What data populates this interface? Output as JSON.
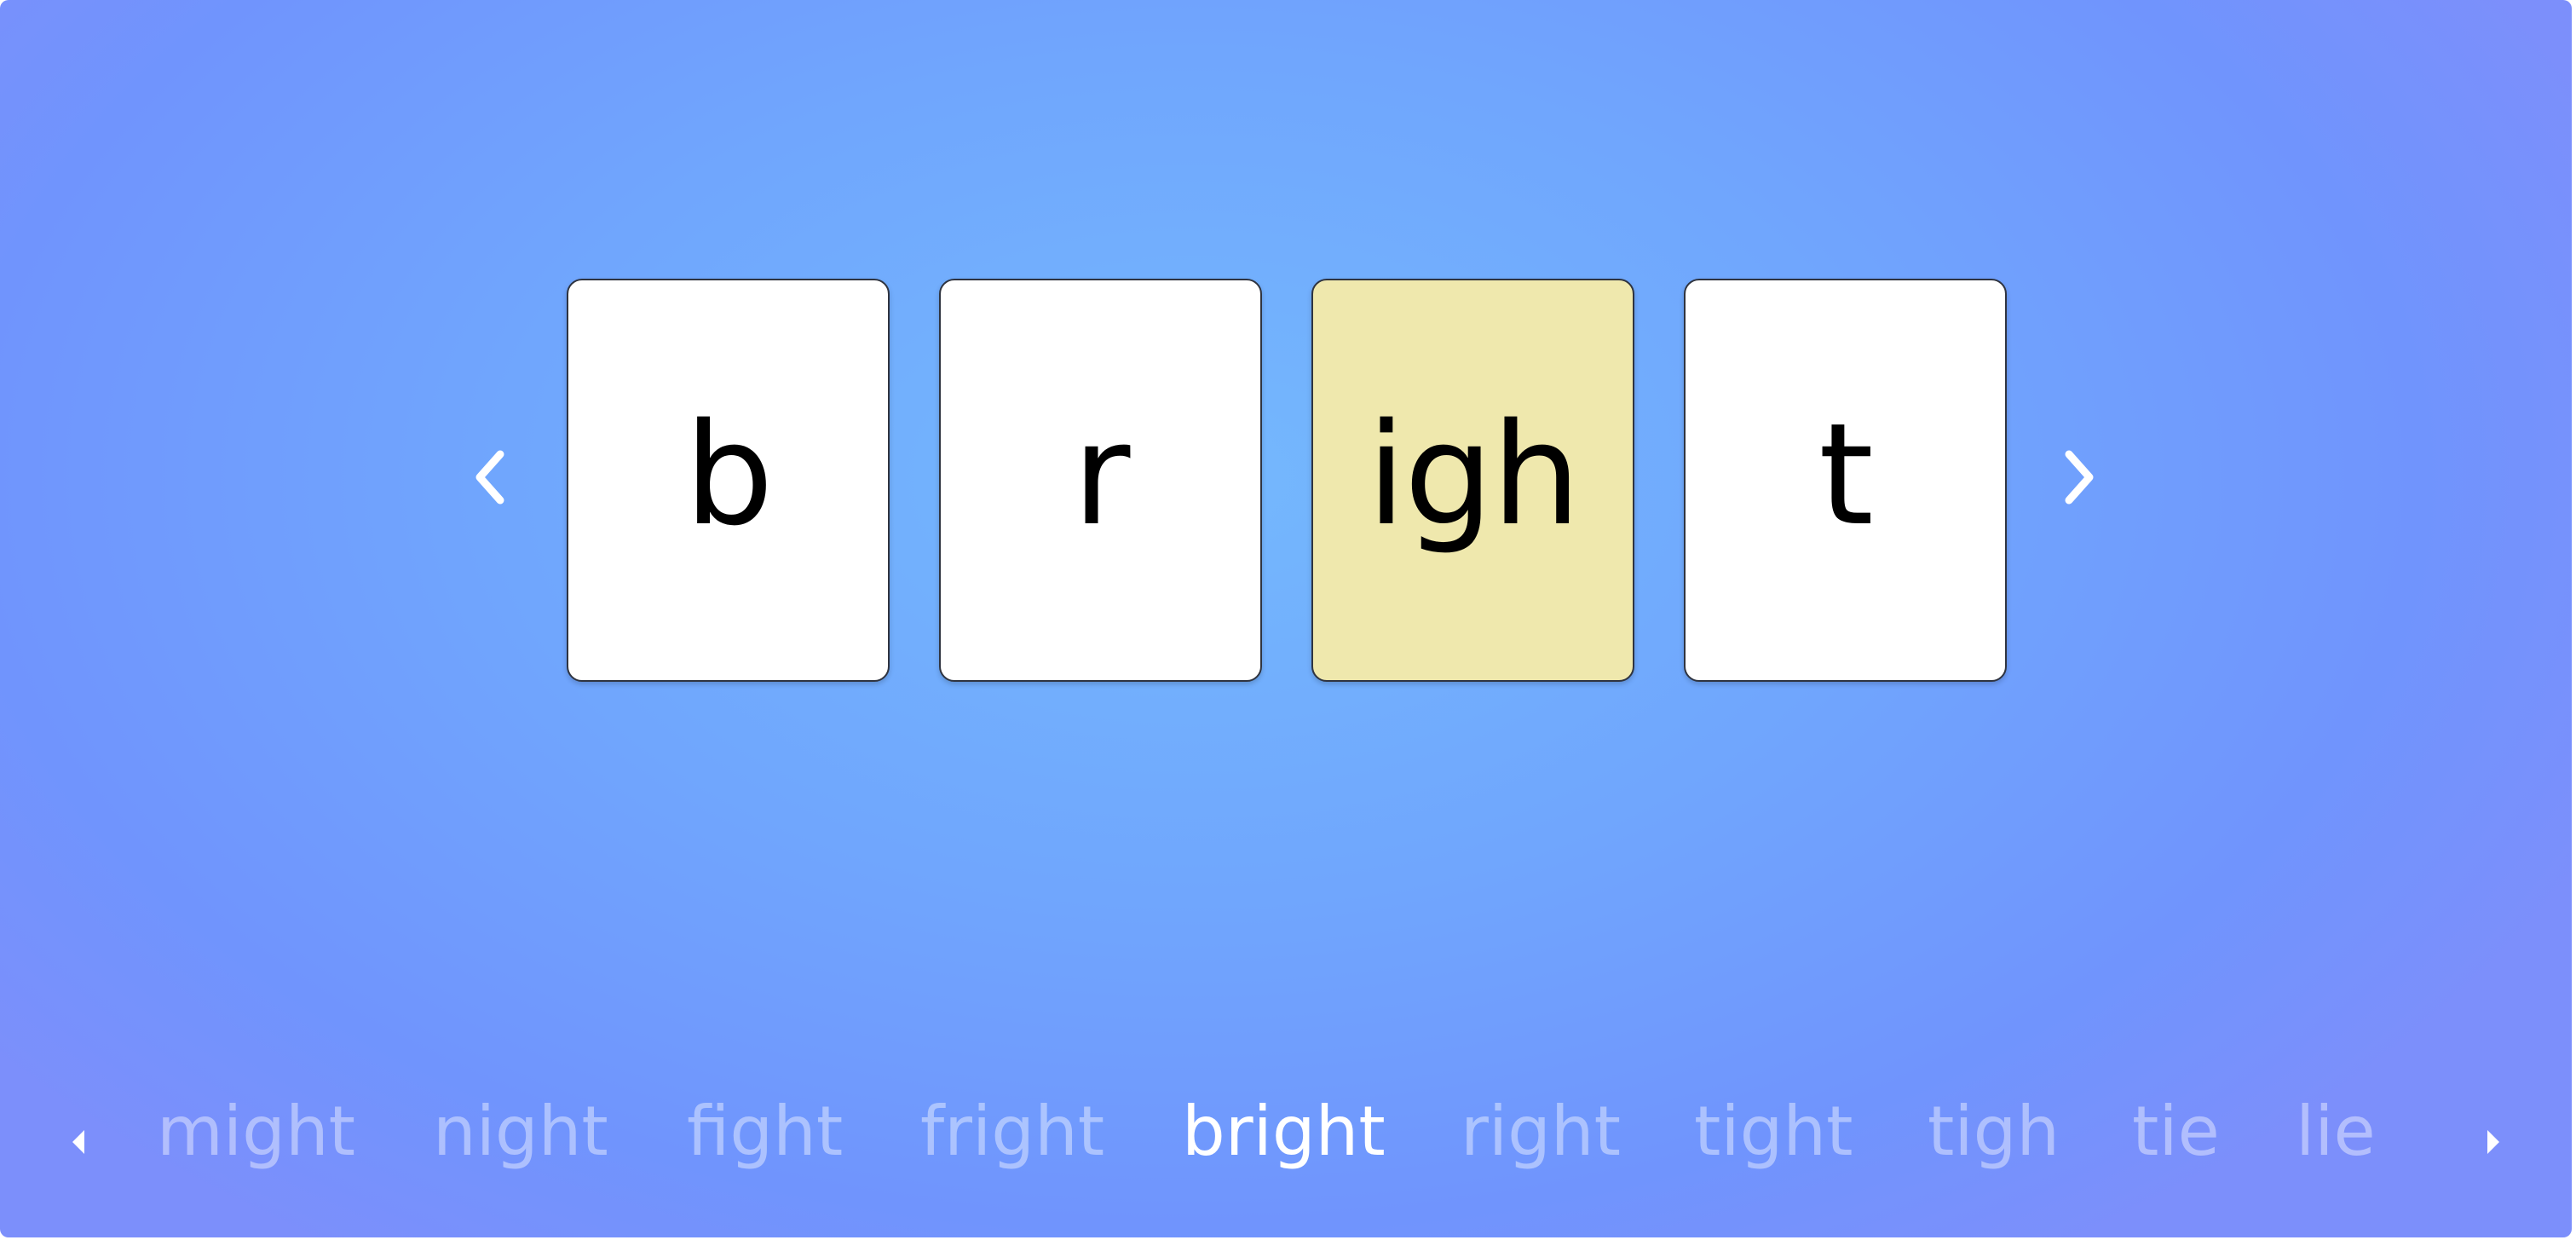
{
  "navigation": {
    "prev_icon": "chevron-left-icon",
    "next_icon": "chevron-right-icon"
  },
  "tiles": [
    {
      "text": "b",
      "highlighted": false
    },
    {
      "text": "r",
      "highlighted": false
    },
    {
      "text": "igh",
      "highlighted": true
    },
    {
      "text": "t",
      "highlighted": false
    }
  ],
  "word_strip": {
    "prev_icon": "triangle-left-icon",
    "next_icon": "triangle-right-icon",
    "selected_index": 4,
    "words": [
      "might",
      "night",
      "fight",
      "fright",
      "bright",
      "right",
      "tight",
      "tigh",
      "tie",
      "lie"
    ]
  },
  "colors": {
    "background_center": "#74b8fd",
    "background_edge": "#7c8ffb",
    "tile": "#ffffff",
    "tile_highlight": "#efe8ad",
    "word_inactive": "rgba(255,255,255,0.42)",
    "word_active": "#ffffff"
  }
}
